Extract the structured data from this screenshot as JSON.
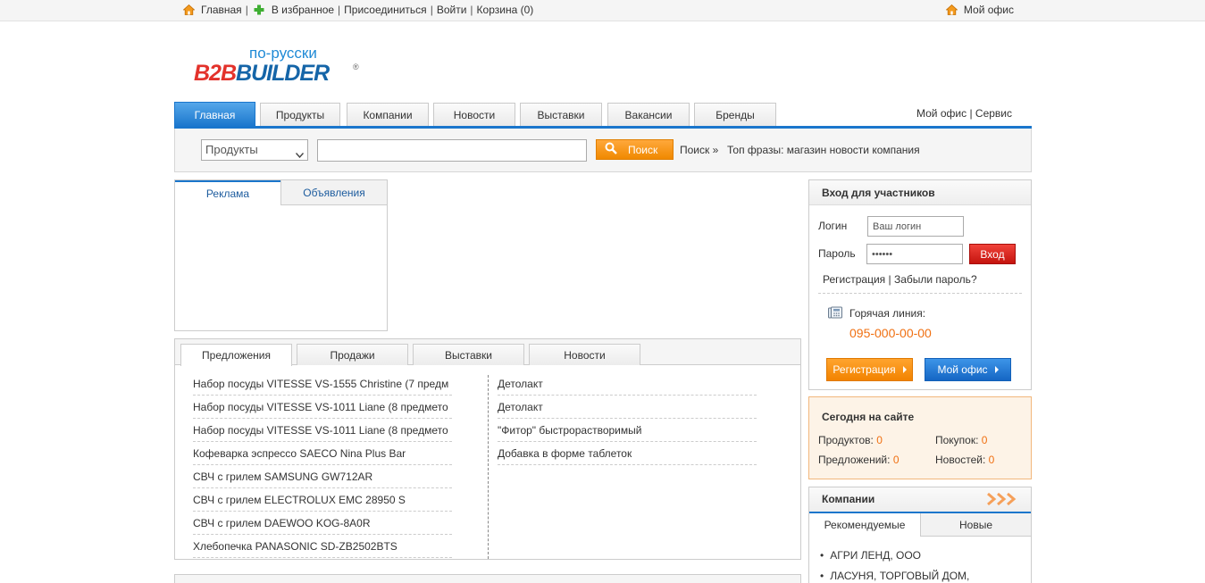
{
  "topbar": {
    "home": "Главная",
    "favorites": "В избранное",
    "join": "Присоединиться",
    "login": "Войти",
    "cart": "Корзина (0)",
    "my_office": "Мой офис",
    "sep": "|"
  },
  "logo": {
    "ru": "по-русски",
    "b2b": "B2B",
    "builder": "BUILDER",
    "reg": "®"
  },
  "nav": {
    "tabs": [
      "Главная",
      "Продукты",
      "Компании",
      "Новости",
      "Выставки",
      "Вакансии",
      "Бренды"
    ],
    "my_office": "Мой офис",
    "sep": "|",
    "service": "Сервис"
  },
  "search": {
    "category": "Продукты",
    "query": "",
    "button": "Поиск",
    "more": "Поиск »",
    "top_label": "Топ фразы:",
    "top_phrases": [
      "магазин",
      "новости",
      "компания"
    ]
  },
  "ad_tabs": [
    "Реклама",
    "Объявления"
  ],
  "offers": {
    "tabs": [
      "Предложения",
      "Продажи",
      "Выставки",
      "Новости"
    ],
    "left": [
      "Набор посуды VITESSE VS-1555 Christine (7 предм",
      "Набор посуды VITESSE VS-1011 Liane (8 предмето",
      "Набор посуды VITESSE VS-1011 Liane (8 предмето",
      "Кофеварка эспрессо SAECO Nina Plus Bar",
      "СВЧ с грилем SAMSUNG GW712AR",
      "СВЧ с грилем ELECTROLUX EMC 28950 S",
      "СВЧ с грилем DAEWOO KOG-8A0R",
      "Хлебопечка PANASONIC SD-ZB2502BTS"
    ],
    "right": [
      "Детолакт",
      "Детолакт",
      "\"Фитор\" быстрорастворимый",
      "Добавка в форме таблеток"
    ]
  },
  "login": {
    "title": "Вход для участников",
    "login_label": "Логин",
    "login_placeholder": "Ваш логин",
    "password_label": "Пароль",
    "password_value": "••••••",
    "submit": "Вход",
    "register_link": "Регистрация",
    "sep": "|",
    "forgot_link": "Забыли пароль?",
    "hotline_label": "Горячая линия:",
    "hotline_number": "095-000-00-00",
    "register_button": "Регистрация",
    "office_button": "Мой офис"
  },
  "today": {
    "title": "Сегодня на сайте",
    "products_label": "Продуктов:",
    "products": "0",
    "purchases_label": "Покупок:",
    "purchases": "0",
    "offers_label": "Предложений:",
    "offers": "0",
    "news_label": "Новостей:",
    "news": "0"
  },
  "companies": {
    "title": "Компании",
    "tabs": [
      "Рекомендуемые",
      "Новые"
    ],
    "list": [
      "АГРИ ЛЕНД, ООО",
      "ЛАСУНЯ, ТОРГОВЫЙ ДОМ,"
    ]
  },
  "colors": {
    "accent_blue": "#1a76cc",
    "accent_orange": "#f07012",
    "login_red": "#c5140e"
  },
  "icons": [
    "home-icon",
    "plus-icon",
    "chevron-down-icon",
    "search-icon",
    "phone-icon",
    "triple-chevron-icon"
  ]
}
